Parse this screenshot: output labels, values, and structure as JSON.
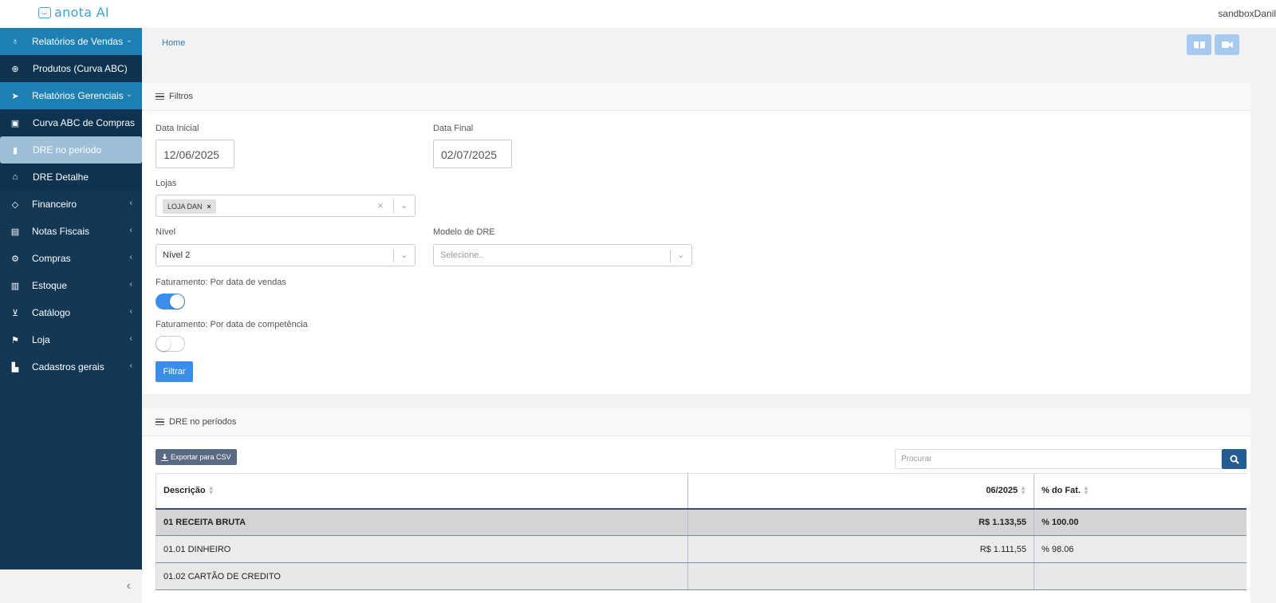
{
  "app": {
    "logo_text": "anota AI",
    "user": "sandboxDanil"
  },
  "sidebar": {
    "items": [
      {
        "label": "Relatórios de Vendas",
        "icon": "lightbulb-icon",
        "glyph": "♁",
        "chevron": "⌄"
      },
      {
        "label": "Produtos (Curva ABC)",
        "icon": "crosshair-icon",
        "glyph": "⊕"
      },
      {
        "label": "Relatórios Gerenciais",
        "icon": "send-icon",
        "glyph": "➤",
        "chevron": "⌄"
      },
      {
        "label": "Curva ABC de Compras",
        "icon": "bus-icon",
        "glyph": "▣"
      },
      {
        "label": "DRE no período",
        "icon": "chart-icon",
        "glyph": "▮"
      },
      {
        "label": "DRE Detalhe",
        "icon": "binoculars-icon",
        "glyph": "⌂"
      },
      {
        "label": "Financeiro",
        "icon": "diamond-icon",
        "glyph": "◇",
        "chevron": "‹"
      },
      {
        "label": "Notas Fiscais",
        "icon": "file-icon",
        "glyph": "▤",
        "chevron": "‹"
      },
      {
        "label": "Compras",
        "icon": "cogs-icon",
        "glyph": "⚙",
        "chevron": "‹"
      },
      {
        "label": "Estoque",
        "icon": "book-icon",
        "glyph": "▥",
        "chevron": "‹"
      },
      {
        "label": "Catálogo",
        "icon": "cart-icon",
        "glyph": "⊻",
        "chevron": "‹"
      },
      {
        "label": "Loja",
        "icon": "flag-icon",
        "glyph": "⚑",
        "chevron": "‹"
      },
      {
        "label": "Cadastros gerais",
        "icon": "industry-icon",
        "glyph": "▙",
        "chevron": "‹"
      }
    ],
    "collapse_glyph": "‹"
  },
  "breadcrumb": {
    "home": "Home"
  },
  "filters": {
    "title": "Filtros",
    "start_label": "Data Inicial",
    "start_value": "12/06/2025",
    "end_label": "Data Final",
    "end_value": "02/07/2025",
    "stores_label": "Lojas",
    "store_tag": "LOJA DAN",
    "tag_remove": "×",
    "clear_glyph": "×",
    "arrow_glyph": "⌄",
    "level_label": "Nível",
    "level_value": "Nível 2",
    "model_label": "Modelo de DRE",
    "model_placeholder": "Selecione..",
    "toggle_sales_label": "Faturamento: Por data de vendas",
    "toggle_sales_on": true,
    "toggle_comp_label": "Faturamento: Por data de competência",
    "toggle_comp_on": false,
    "filter_button": "Filtrar"
  },
  "results": {
    "title": "DRE no períodos",
    "export_button": "Exportar para CSV",
    "search_placeholder": "Procurar",
    "columns": [
      "Descrição",
      "06/2025",
      "% do Fat."
    ],
    "rows": [
      {
        "desc": "01 RECEITA BRUTA",
        "value": "R$ 1.133,55",
        "pct": "% 100.00"
      },
      {
        "desc": "01.01 DINHEIRO",
        "value": "R$ 1.111,55",
        "pct": "% 98.06"
      },
      {
        "desc": "01.02 CARTÃO DE CREDITO",
        "value": "",
        "pct": ""
      }
    ]
  }
}
